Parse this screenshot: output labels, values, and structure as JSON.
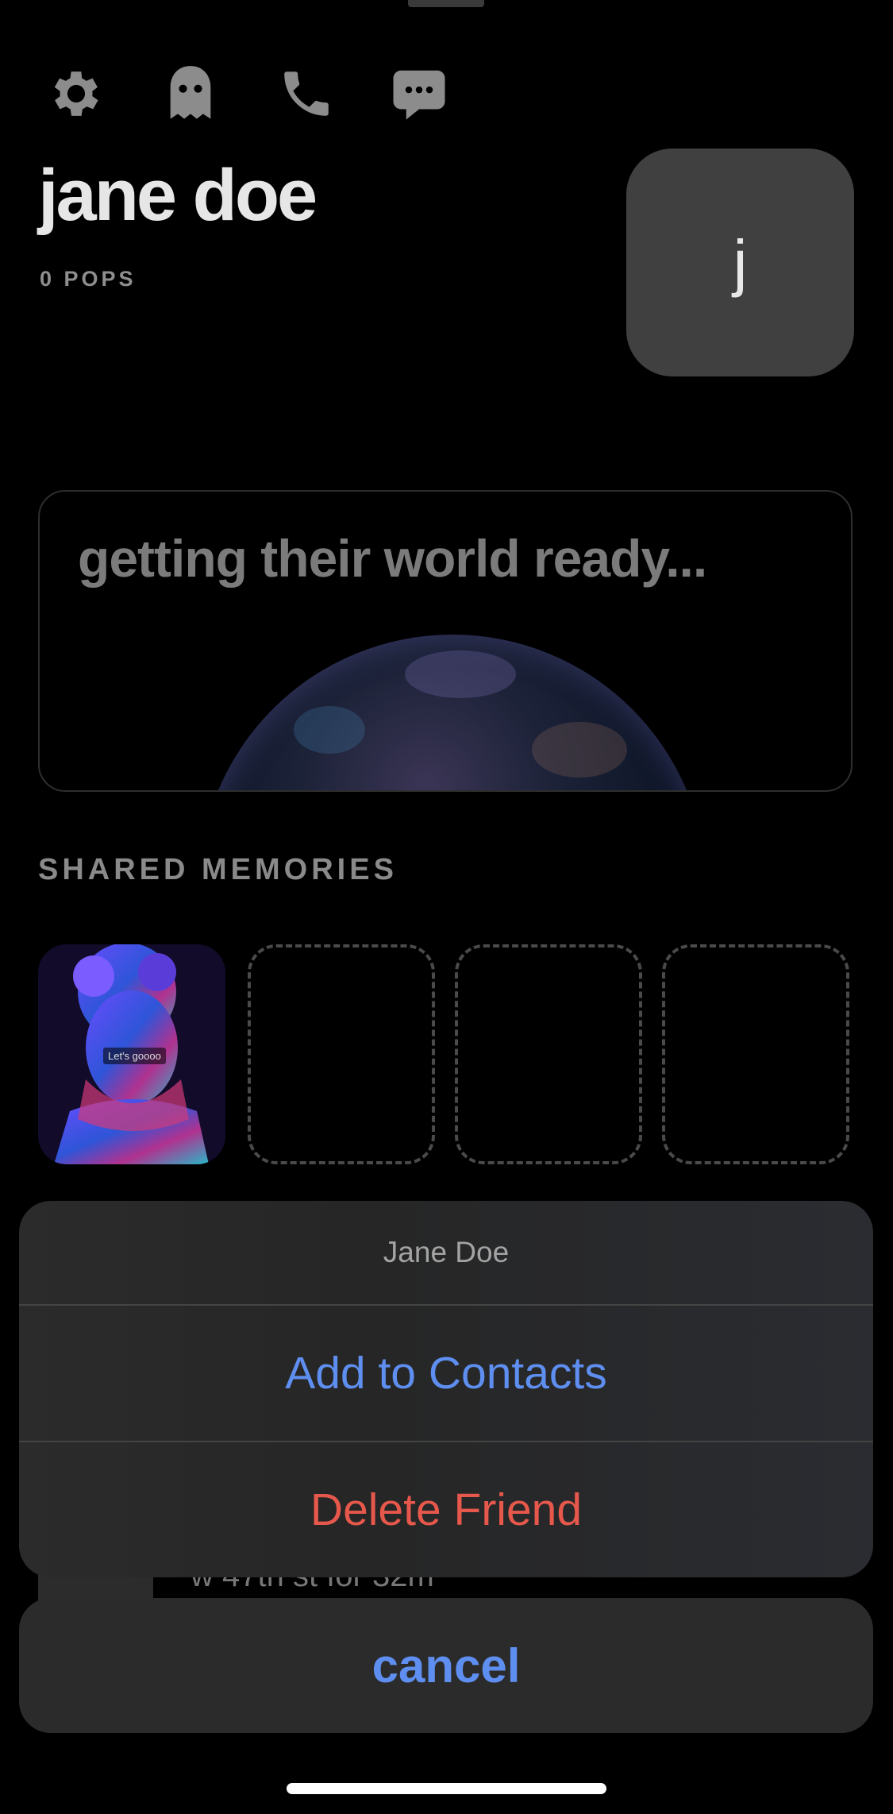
{
  "toolbar": {
    "icons": [
      "gear-icon",
      "ghost-icon",
      "phone-icon",
      "message-icon"
    ]
  },
  "profile": {
    "name": "jane doe",
    "pops": "0 POPS",
    "avatar_initial": "j"
  },
  "world": {
    "status_text": "getting their world ready..."
  },
  "shared_memories": {
    "title": "SHARED MEMORIES",
    "first_caption": "Let's goooo"
  },
  "background_row": {
    "text": "w 47th st for 32m"
  },
  "action_sheet": {
    "title": "Jane Doe",
    "add_label": "Add to Contacts",
    "delete_label": "Delete Friend",
    "cancel_label": "cancel"
  },
  "colors": {
    "action_blue": "#5e8ff0",
    "destructive_red": "#e6584b"
  }
}
